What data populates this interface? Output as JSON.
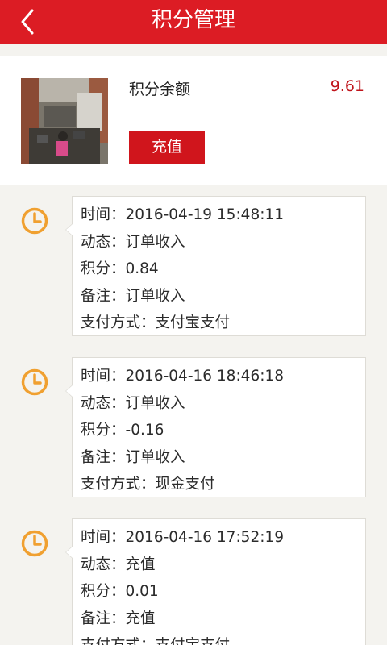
{
  "header": {
    "title": "积分管理",
    "back_icon": "chevron-left-icon",
    "background": "#dc1c24"
  },
  "balance": {
    "label": "积分余额",
    "amount": "9.61",
    "recharge_label": "充值",
    "accent": "#d0151c"
  },
  "field_labels": {
    "time": "时间：",
    "status": "动态：",
    "points": "积分：",
    "note": "备注：",
    "payment": "支付方式："
  },
  "records": [
    {
      "time": "2016-04-19 15:48:11",
      "status": "订单收入",
      "points": "0.84",
      "note": "订单收入",
      "payment": "支付宝支付"
    },
    {
      "time": "2016-04-16 18:46:18",
      "status": "订单收入",
      "points": "-0.16",
      "note": "订单收入",
      "payment": "现金支付"
    },
    {
      "time": "2016-04-16 17:52:19",
      "status": "充值",
      "points": "0.01",
      "note": "充值",
      "payment": "支付宝支付"
    }
  ],
  "clock_color": "#f0a030"
}
